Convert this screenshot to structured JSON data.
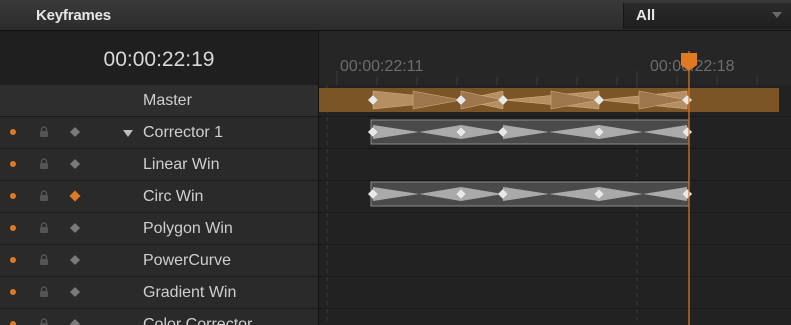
{
  "header": {
    "title": "Keyframes",
    "filter_value": "All"
  },
  "timecode": "00:00:22:19",
  "ruler": {
    "label_left": "00:00:22:11",
    "label_right": "00:00:22:18"
  },
  "tracks": [
    {
      "label": "Master"
    },
    {
      "label": "Corrector 1"
    },
    {
      "label": "Linear Win"
    },
    {
      "label": "Circ Win"
    },
    {
      "label": "Polygon Win"
    },
    {
      "label": "PowerCurve"
    },
    {
      "label": "Gradient Win"
    },
    {
      "label": "Color Corrector"
    }
  ],
  "colors": {
    "accent": "#e07a22",
    "master_track": "#8a5a2a",
    "keyframe_segment": "#b9b9b9"
  }
}
